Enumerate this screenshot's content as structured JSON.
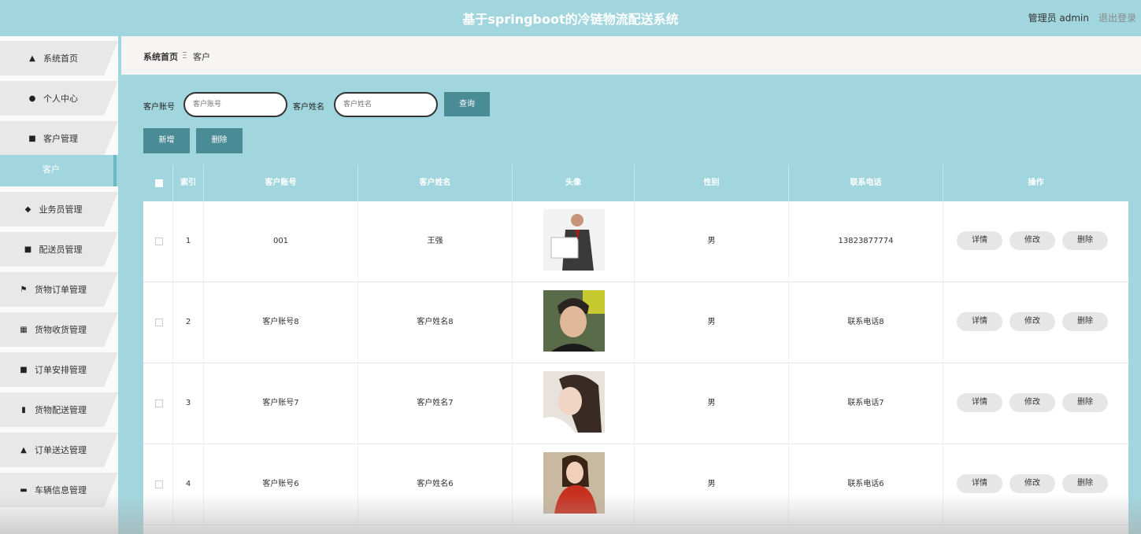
{
  "header": {
    "title": "基于springboot的冷链物流配送系统",
    "user": "管理员 admin",
    "logout": "退出登录"
  },
  "sidebar": {
    "items": [
      {
        "label": "系统首页",
        "icon": "home-icon"
      },
      {
        "label": "个人中心",
        "icon": "user-icon"
      },
      {
        "label": "客户管理",
        "icon": "clipboard-icon"
      },
      {
        "label": "业务员管理",
        "icon": "map-pin-icon"
      },
      {
        "label": "配送员管理",
        "icon": "clipboard-list-icon"
      },
      {
        "label": "货物订单管理",
        "icon": "flag-icon"
      },
      {
        "label": "货物收货管理",
        "icon": "grid-icon"
      },
      {
        "label": "订单安排管理",
        "icon": "clipboard-icon"
      },
      {
        "label": "货物配送管理",
        "icon": "bar-chart-icon"
      },
      {
        "label": "订单送达管理",
        "icon": "thumbs-up-icon"
      },
      {
        "label": "车辆信息管理",
        "icon": "printer-icon"
      }
    ],
    "active_sub": "客户"
  },
  "breadcrumb": {
    "home": "系统首页",
    "sep": "Ξ",
    "current": "客户"
  },
  "search": {
    "account_label": "客户账号",
    "account_placeholder": "客户账号",
    "name_label": "客户姓名",
    "name_placeholder": "客户姓名",
    "query_button": "查询"
  },
  "actions": {
    "add": "新增",
    "delete": "删除"
  },
  "table": {
    "headers": [
      "索引",
      "客户账号",
      "客户姓名",
      "头像",
      "性别",
      "联系电话",
      "操作"
    ],
    "rows": [
      {
        "index": "1",
        "account": "001",
        "name": "王强",
        "gender": "男",
        "phone": "13823877774"
      },
      {
        "index": "2",
        "account": "客户账号8",
        "name": "客户姓名8",
        "gender": "男",
        "phone": "联系电话8"
      },
      {
        "index": "3",
        "account": "客户账号7",
        "name": "客户姓名7",
        "gender": "男",
        "phone": "联系电话7"
      },
      {
        "index": "4",
        "account": "客户账号6",
        "name": "客户姓名6",
        "gender": "男",
        "phone": "联系电话6"
      }
    ],
    "row_actions": {
      "detail": "详情",
      "edit": "修改",
      "delete": "删除"
    }
  },
  "colors": {
    "header": "#a2d6de",
    "button": "#4a8c95",
    "sidebar_item": "#e8e8e8"
  }
}
